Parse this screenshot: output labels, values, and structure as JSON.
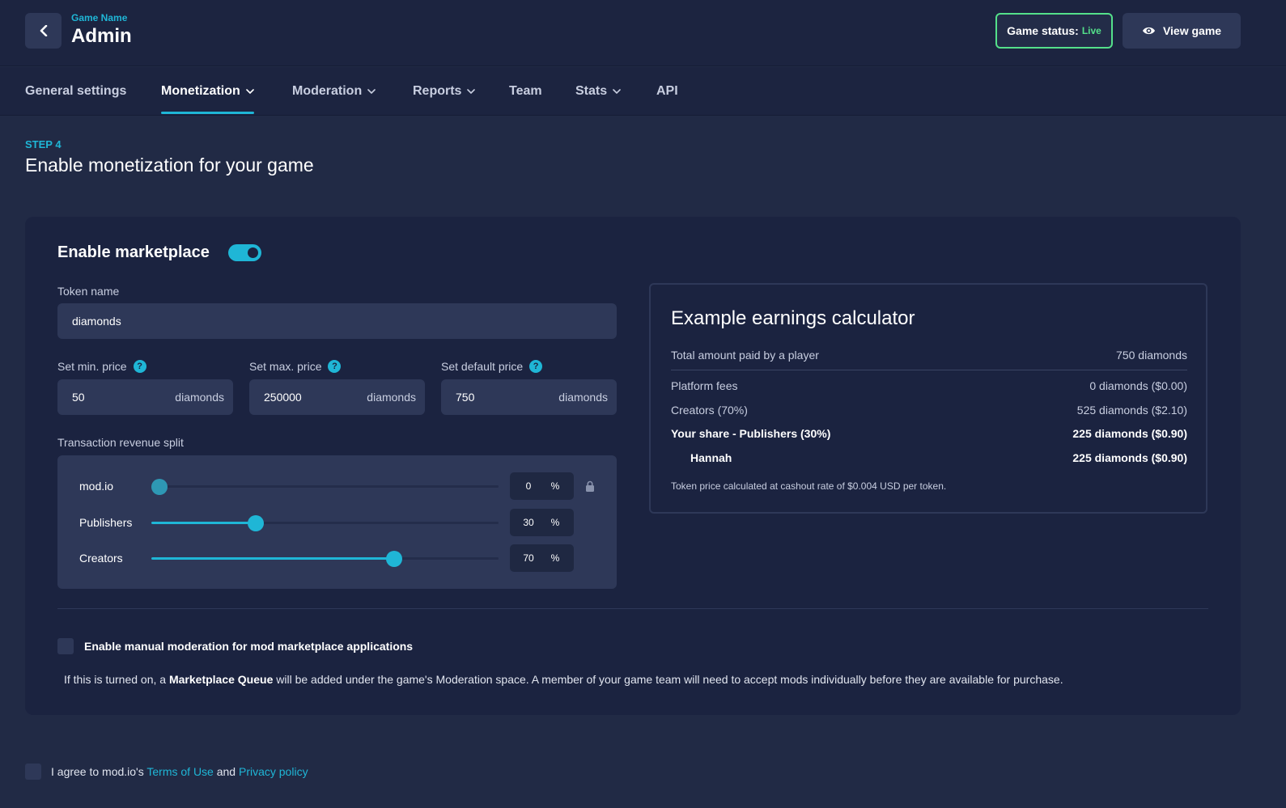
{
  "header": {
    "game_name": "Game Name",
    "title": "Admin",
    "status_label": "Game status:",
    "status_value": "Live",
    "view_game_label": "View game"
  },
  "nav": {
    "items": [
      {
        "label": "General settings",
        "dropdown": false,
        "active": false
      },
      {
        "label": "Monetization",
        "dropdown": true,
        "active": true
      },
      {
        "label": "Moderation",
        "dropdown": true,
        "active": false
      },
      {
        "label": "Reports",
        "dropdown": true,
        "active": false
      },
      {
        "label": "Team",
        "dropdown": false,
        "active": false
      },
      {
        "label": "Stats",
        "dropdown": true,
        "active": false
      },
      {
        "label": "API",
        "dropdown": false,
        "active": false
      }
    ]
  },
  "step": {
    "label": "STEP 4",
    "title": "Enable monetization for your game"
  },
  "marketplace": {
    "title": "Enable marketplace",
    "enabled": true,
    "token_name_label": "Token name",
    "token_name_value": "diamonds",
    "min_price": {
      "label": "Set min. price",
      "value": "50",
      "unit": "diamonds"
    },
    "max_price": {
      "label": "Set max. price",
      "value": "250000",
      "unit": "diamonds"
    },
    "default_price": {
      "label": "Set default price",
      "value": "750",
      "unit": "diamonds"
    },
    "split_label": "Transaction revenue split",
    "split": [
      {
        "name": "mod.io",
        "value": "0",
        "percent": 0,
        "locked": true
      },
      {
        "name": "Publishers",
        "value": "30",
        "percent": 30,
        "locked": false
      },
      {
        "name": "Creators",
        "value": "70",
        "percent": 70,
        "locked": false
      }
    ],
    "percent_sign": "%"
  },
  "calculator": {
    "title": "Example earnings calculator",
    "total_label": "Total amount paid by a player",
    "total_value": "750 diamonds",
    "rows": [
      {
        "label": "Platform fees",
        "value": "0 diamonds ($0.00)",
        "bold": false
      },
      {
        "label": "Creators (70%)",
        "value": "525 diamonds ($2.10)",
        "bold": false
      },
      {
        "label": "Your share - Publishers (30%)",
        "value": "225 diamonds ($0.90)",
        "bold": true
      },
      {
        "label": "Hannah",
        "value": "225 diamonds ($0.90)",
        "bold": true
      }
    ],
    "note": "Token price calculated at cashout rate of $0.004 USD per token."
  },
  "moderation": {
    "checkbox_label": "Enable manual moderation for mod marketplace applications",
    "desc_prefix": "If this is turned on, a ",
    "desc_bold": "Marketplace Queue",
    "desc_suffix": " will be added under the game's Moderation space. A member of your game team will need to accept mods individually before they are available for purchase."
  },
  "agreement": {
    "prefix": "I agree to mod.io's ",
    "terms": "Terms of Use",
    "and": " and ",
    "privacy": "Privacy policy"
  },
  "colors": {
    "accent": "#1fb6d6",
    "live": "#54e08a",
    "background": "#212a45",
    "card": "#1b2340",
    "input": "#2e3858"
  }
}
